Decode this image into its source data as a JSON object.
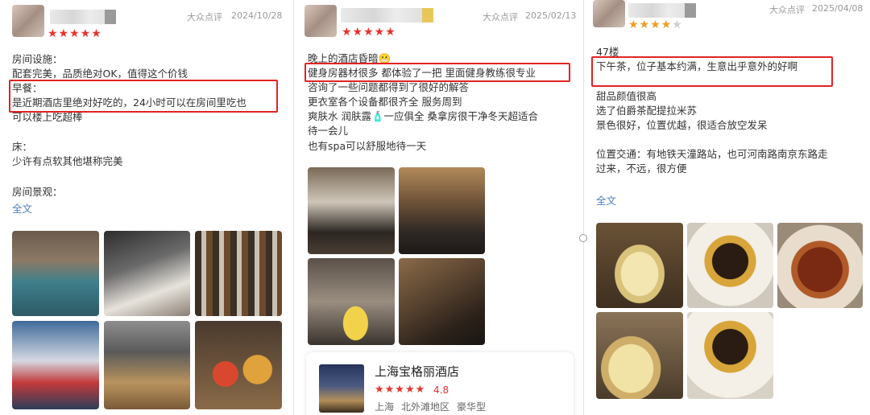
{
  "colors": {
    "star_red": "#e8322d",
    "star_orange": "#f39a1e",
    "highlight": "#e02424",
    "link": "#4a7fc1"
  },
  "reviews": [
    {
      "source": "大众点评",
      "date": "2024/10/28",
      "rating": 5,
      "lines": [
        "房间设施：",
        "配套完美，品质绝对OK，值得这个价钱",
        "早餐：",
        "是近期酒店里绝对好吃的，24小时可以在房间里吃也",
        "可以楼上吃超棒",
        "",
        "床：",
        "少许有点软其他堪称完美",
        "",
        "房间景观："
      ],
      "more_link": "全文",
      "photos": [
        "indoor-pool-photo",
        "hotel-bedroom-photo",
        "minibar-drinks-photo",
        "amenity-tray-photo",
        "gym-photo",
        "snack-jars-photo"
      ]
    },
    {
      "source": "大众点评",
      "date": "2025/02/13",
      "rating": 5,
      "lines": [
        "晚上的酒店昏暗😬",
        "健身房器材很多 都体验了一把 里面健身教练很专业",
        "咨询了一些问题都得到了很好的解答",
        "更衣室各个设备都很齐全 服务周到",
        "爽肤水 润肤露🧴一应俱全 桑拿房很干净冬天超适合",
        "待一会儿",
        "也有spa可以舒服地待一天"
      ],
      "photos": [
        "gym-drinks-photo",
        "gym-treadmill-photo",
        "water-banana-photo",
        "changing-room-photo"
      ],
      "hotel_card": {
        "name": "上海宝格丽酒店",
        "rating": "4.8",
        "stars": 5,
        "city": "上海",
        "district": "北外滩地区",
        "category": "豪华型"
      }
    },
    {
      "source": "大众点评",
      "date": "2025/04/08",
      "rating": 4,
      "lines": [
        "47楼",
        "下午茶，位子基本约满，生意出乎意外的好啊",
        "",
        "甜品颜值很高",
        "选了伯爵茶配提拉米苏",
        "景色很好，位置优越，很适合放空发呆",
        "",
        "位置交通：有地铁天潼路站，也可河南路南京东路走",
        "过来，不远，很方便"
      ],
      "more_link": "全文",
      "photos": [
        "cake-roll-photo",
        "chocolate-dessert-photo",
        "tea-cup-photo",
        "cake-roll-closeup-photo",
        "chocolate-disc-photo"
      ]
    }
  ]
}
